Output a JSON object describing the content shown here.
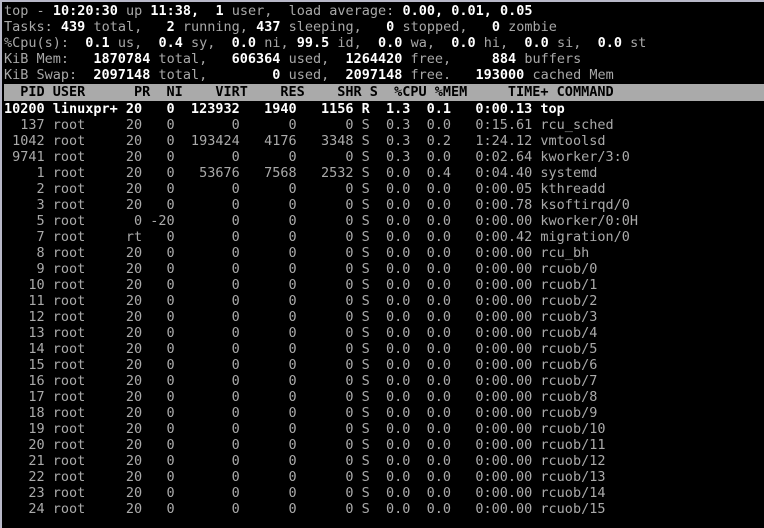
{
  "terminal": {
    "program": "top",
    "summary": {
      "uptime_line": {
        "program": "top",
        "dash": "-",
        "time": "10:20:30",
        "up_label": "up",
        "uptime": "11:38,",
        "users": "1",
        "users_label": "user,",
        "load_label": "load average:",
        "load1": "0.00,",
        "load5": "0.01,",
        "load15": "0.05"
      },
      "tasks_line": {
        "label": "Tasks:",
        "total": "439",
        "total_label": "total,",
        "running": "2",
        "running_label": "running,",
        "sleeping": "437",
        "sleeping_label": "sleeping,",
        "stopped": "0",
        "stopped_label": "stopped,",
        "zombie": "0",
        "zombie_label": "zombie"
      },
      "cpu_line": {
        "label": "%Cpu(s):",
        "us": "0.1",
        "us_label": "us,",
        "sy": "0.4",
        "sy_label": "sy,",
        "ni": "0.0",
        "ni_label": "ni,",
        "id": "99.5",
        "id_label": "id,",
        "wa": "0.0",
        "wa_label": "wa,",
        "hi": "0.0",
        "hi_label": "hi,",
        "si": "0.0",
        "si_label": "si,",
        "st": "0.0",
        "st_label": "st"
      },
      "mem_line": {
        "label": "KiB Mem:",
        "total": "1870784",
        "total_label": "total,",
        "used": "606364",
        "used_label": "used,",
        "free": "1264420",
        "free_label": "free,",
        "buffers": "884",
        "buffers_label": "buffers"
      },
      "swap_line": {
        "label": "KiB Swap:",
        "total": "2097148",
        "total_label": "total,",
        "used": "0",
        "used_label": "used,",
        "free": "2097148",
        "free_label": "free.",
        "cached": "193000",
        "cached_label": "cached Mem"
      }
    },
    "columns": [
      "PID",
      "USER",
      "PR",
      "NI",
      "VIRT",
      "RES",
      "SHR",
      "S",
      "%CPU",
      "%MEM",
      "TIME+",
      "COMMAND"
    ],
    "header_text": "  PID USER      PR  NI    VIRT    RES    SHR S  %CPU %MEM     TIME+ COMMAND                 ",
    "processes": [
      {
        "pid": "10200",
        "user": "linuxpr+",
        "pr": "20",
        "ni": "0",
        "virt": "123932",
        "res": "1940",
        "shr": "1156",
        "s": "R",
        "cpu": "1.3",
        "mem": "0.1",
        "time": "0:00.13",
        "command": "top",
        "bold": true
      },
      {
        "pid": "137",
        "user": "root",
        "pr": "20",
        "ni": "0",
        "virt": "0",
        "res": "0",
        "shr": "0",
        "s": "S",
        "cpu": "0.3",
        "mem": "0.0",
        "time": "0:15.61",
        "command": "rcu_sched",
        "bold": false
      },
      {
        "pid": "1042",
        "user": "root",
        "pr": "20",
        "ni": "0",
        "virt": "193424",
        "res": "4176",
        "shr": "3348",
        "s": "S",
        "cpu": "0.3",
        "mem": "0.2",
        "time": "1:24.12",
        "command": "vmtoolsd",
        "bold": false
      },
      {
        "pid": "9741",
        "user": "root",
        "pr": "20",
        "ni": "0",
        "virt": "0",
        "res": "0",
        "shr": "0",
        "s": "S",
        "cpu": "0.3",
        "mem": "0.0",
        "time": "0:02.64",
        "command": "kworker/3:0",
        "bold": false
      },
      {
        "pid": "1",
        "user": "root",
        "pr": "20",
        "ni": "0",
        "virt": "53676",
        "res": "7568",
        "shr": "2532",
        "s": "S",
        "cpu": "0.0",
        "mem": "0.4",
        "time": "0:04.40",
        "command": "systemd",
        "bold": false
      },
      {
        "pid": "2",
        "user": "root",
        "pr": "20",
        "ni": "0",
        "virt": "0",
        "res": "0",
        "shr": "0",
        "s": "S",
        "cpu": "0.0",
        "mem": "0.0",
        "time": "0:00.05",
        "command": "kthreadd",
        "bold": false
      },
      {
        "pid": "3",
        "user": "root",
        "pr": "20",
        "ni": "0",
        "virt": "0",
        "res": "0",
        "shr": "0",
        "s": "S",
        "cpu": "0.0",
        "mem": "0.0",
        "time": "0:00.78",
        "command": "ksoftirqd/0",
        "bold": false
      },
      {
        "pid": "5",
        "user": "root",
        "pr": "0",
        "ni": "-20",
        "virt": "0",
        "res": "0",
        "shr": "0",
        "s": "S",
        "cpu": "0.0",
        "mem": "0.0",
        "time": "0:00.00",
        "command": "kworker/0:0H",
        "bold": false
      },
      {
        "pid": "7",
        "user": "root",
        "pr": "rt",
        "ni": "0",
        "virt": "0",
        "res": "0",
        "shr": "0",
        "s": "S",
        "cpu": "0.0",
        "mem": "0.0",
        "time": "0:00.42",
        "command": "migration/0",
        "bold": false
      },
      {
        "pid": "8",
        "user": "root",
        "pr": "20",
        "ni": "0",
        "virt": "0",
        "res": "0",
        "shr": "0",
        "s": "S",
        "cpu": "0.0",
        "mem": "0.0",
        "time": "0:00.00",
        "command": "rcu_bh",
        "bold": false
      },
      {
        "pid": "9",
        "user": "root",
        "pr": "20",
        "ni": "0",
        "virt": "0",
        "res": "0",
        "shr": "0",
        "s": "S",
        "cpu": "0.0",
        "mem": "0.0",
        "time": "0:00.00",
        "command": "rcuob/0",
        "bold": false
      },
      {
        "pid": "10",
        "user": "root",
        "pr": "20",
        "ni": "0",
        "virt": "0",
        "res": "0",
        "shr": "0",
        "s": "S",
        "cpu": "0.0",
        "mem": "0.0",
        "time": "0:00.00",
        "command": "rcuob/1",
        "bold": false
      },
      {
        "pid": "11",
        "user": "root",
        "pr": "20",
        "ni": "0",
        "virt": "0",
        "res": "0",
        "shr": "0",
        "s": "S",
        "cpu": "0.0",
        "mem": "0.0",
        "time": "0:00.00",
        "command": "rcuob/2",
        "bold": false
      },
      {
        "pid": "12",
        "user": "root",
        "pr": "20",
        "ni": "0",
        "virt": "0",
        "res": "0",
        "shr": "0",
        "s": "S",
        "cpu": "0.0",
        "mem": "0.0",
        "time": "0:00.00",
        "command": "rcuob/3",
        "bold": false
      },
      {
        "pid": "13",
        "user": "root",
        "pr": "20",
        "ni": "0",
        "virt": "0",
        "res": "0",
        "shr": "0",
        "s": "S",
        "cpu": "0.0",
        "mem": "0.0",
        "time": "0:00.00",
        "command": "rcuob/4",
        "bold": false
      },
      {
        "pid": "14",
        "user": "root",
        "pr": "20",
        "ni": "0",
        "virt": "0",
        "res": "0",
        "shr": "0",
        "s": "S",
        "cpu": "0.0",
        "mem": "0.0",
        "time": "0:00.00",
        "command": "rcuob/5",
        "bold": false
      },
      {
        "pid": "15",
        "user": "root",
        "pr": "20",
        "ni": "0",
        "virt": "0",
        "res": "0",
        "shr": "0",
        "s": "S",
        "cpu": "0.0",
        "mem": "0.0",
        "time": "0:00.00",
        "command": "rcuob/6",
        "bold": false
      },
      {
        "pid": "16",
        "user": "root",
        "pr": "20",
        "ni": "0",
        "virt": "0",
        "res": "0",
        "shr": "0",
        "s": "S",
        "cpu": "0.0",
        "mem": "0.0",
        "time": "0:00.00",
        "command": "rcuob/7",
        "bold": false
      },
      {
        "pid": "17",
        "user": "root",
        "pr": "20",
        "ni": "0",
        "virt": "0",
        "res": "0",
        "shr": "0",
        "s": "S",
        "cpu": "0.0",
        "mem": "0.0",
        "time": "0:00.00",
        "command": "rcuob/8",
        "bold": false
      },
      {
        "pid": "18",
        "user": "root",
        "pr": "20",
        "ni": "0",
        "virt": "0",
        "res": "0",
        "shr": "0",
        "s": "S",
        "cpu": "0.0",
        "mem": "0.0",
        "time": "0:00.00",
        "command": "rcuob/9",
        "bold": false
      },
      {
        "pid": "19",
        "user": "root",
        "pr": "20",
        "ni": "0",
        "virt": "0",
        "res": "0",
        "shr": "0",
        "s": "S",
        "cpu": "0.0",
        "mem": "0.0",
        "time": "0:00.00",
        "command": "rcuob/10",
        "bold": false
      },
      {
        "pid": "20",
        "user": "root",
        "pr": "20",
        "ni": "0",
        "virt": "0",
        "res": "0",
        "shr": "0",
        "s": "S",
        "cpu": "0.0",
        "mem": "0.0",
        "time": "0:00.00",
        "command": "rcuob/11",
        "bold": false
      },
      {
        "pid": "21",
        "user": "root",
        "pr": "20",
        "ni": "0",
        "virt": "0",
        "res": "0",
        "shr": "0",
        "s": "S",
        "cpu": "0.0",
        "mem": "0.0",
        "time": "0:00.00",
        "command": "rcuob/12",
        "bold": false
      },
      {
        "pid": "22",
        "user": "root",
        "pr": "20",
        "ni": "0",
        "virt": "0",
        "res": "0",
        "shr": "0",
        "s": "S",
        "cpu": "0.0",
        "mem": "0.0",
        "time": "0:00.00",
        "command": "rcuob/13",
        "bold": false
      },
      {
        "pid": "23",
        "user": "root",
        "pr": "20",
        "ni": "0",
        "virt": "0",
        "res": "0",
        "shr": "0",
        "s": "S",
        "cpu": "0.0",
        "mem": "0.0",
        "time": "0:00.00",
        "command": "rcuob/14",
        "bold": false
      },
      {
        "pid": "24",
        "user": "root",
        "pr": "20",
        "ni": "0",
        "virt": "0",
        "res": "0",
        "shr": "0",
        "s": "S",
        "cpu": "0.0",
        "mem": "0.0",
        "time": "0:00.00",
        "command": "rcuob/15",
        "bold": false
      }
    ]
  },
  "colors": {
    "background": "#000000",
    "foreground": "#aaaaaa",
    "bright": "#ffffff",
    "header_bg": "#aaaaaa",
    "header_fg": "#000000",
    "border": "#b8b8c8"
  }
}
